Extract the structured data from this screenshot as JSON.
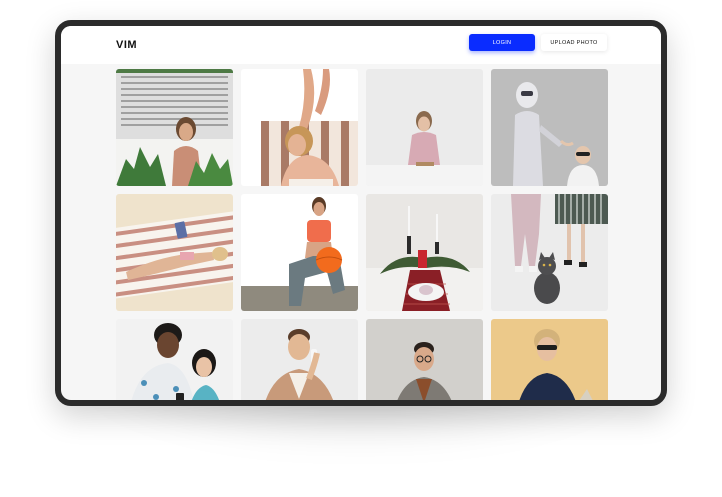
{
  "app": {
    "logo": "VIM"
  },
  "header": {
    "login_label": "LOGIN",
    "upload_label": "UPLOAD PHOTO"
  },
  "colors": {
    "primary": "#0a2cff",
    "device_frame": "#2b2b2b",
    "page_background": "#f6f6f6"
  },
  "gallery": {
    "photos": [
      {
        "id": "woman-plants-window"
      },
      {
        "id": "woman-lounging-striped-chair"
      },
      {
        "id": "woman-reading-table"
      },
      {
        "id": "robot-and-girl-sunglasses"
      },
      {
        "id": "woman-tablet-beach-towel"
      },
      {
        "id": "woman-orange-ball"
      },
      {
        "id": "christmas-table-candles"
      },
      {
        "id": "cat-with-people-legs"
      },
      {
        "id": "couple-looking-at-phone"
      },
      {
        "id": "man-on-phone-smiling"
      },
      {
        "id": "man-glasses-suit"
      },
      {
        "id": "woman-sunglasses-yellow"
      }
    ]
  }
}
